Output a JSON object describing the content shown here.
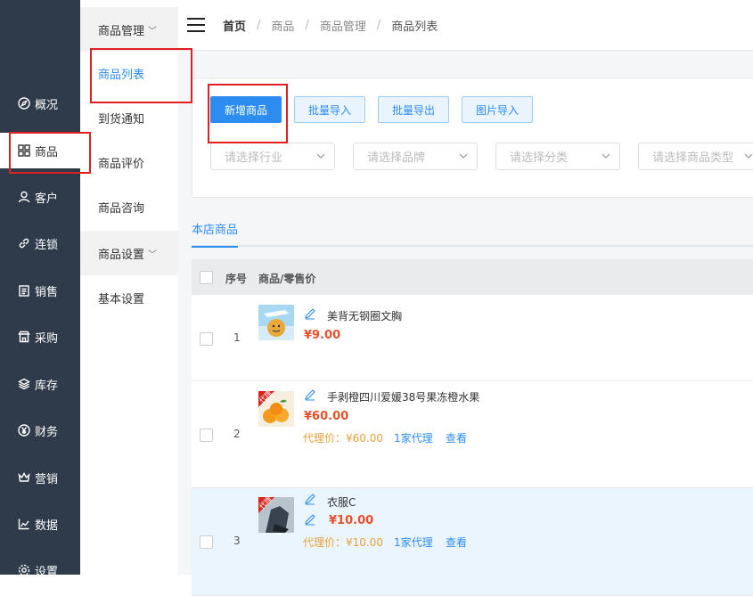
{
  "nav": {
    "items": [
      {
        "label": "概况",
        "icon": "compass-icon"
      },
      {
        "label": "商品",
        "icon": "grid-icon"
      },
      {
        "label": "客户",
        "icon": "user-icon"
      },
      {
        "label": "连锁",
        "icon": "link-icon"
      },
      {
        "label": "销售",
        "icon": "clipboard-icon"
      },
      {
        "label": "采购",
        "icon": "store-icon"
      },
      {
        "label": "库存",
        "icon": "layers-icon"
      },
      {
        "label": "财务",
        "icon": "yen-icon"
      },
      {
        "label": "营销",
        "icon": "crown-icon"
      },
      {
        "label": "数据",
        "icon": "line-chart-icon"
      },
      {
        "label": "设置",
        "icon": "gear-icon"
      }
    ]
  },
  "subnav": {
    "group1": "商品管理",
    "items1": [
      "商品列表",
      "到货通知",
      "商品评价",
      "商品咨询"
    ],
    "group2": "商品设置",
    "items2": [
      "基本设置"
    ]
  },
  "header": {
    "home": "首页",
    "crumb1": "商品",
    "crumb2": "商品管理",
    "crumb3": "商品列表"
  },
  "toolbar": {
    "add": "新增商品",
    "import": "批量导入",
    "export": "批量导出",
    "image_import": "图片导入"
  },
  "filters": {
    "industry": "请选择行业",
    "brand": "请选择品牌",
    "category": "请选择分类",
    "type": "请选择商品类型"
  },
  "tabs": {
    "store": "本店商品"
  },
  "table": {
    "col_index": "序号",
    "col_product": "商品/零售价",
    "rows": [
      {
        "index": "1",
        "name": "美背无钢圈文胸",
        "price": "¥9.00"
      },
      {
        "index": "2",
        "name": "手剥橙四川爱媛38号果冻橙水果",
        "price": "¥60.00",
        "agent_price": "代理价：¥60.00",
        "agent_count": "1家代理",
        "view": "查看",
        "badge": "代理"
      },
      {
        "index": "3",
        "name": "衣服C",
        "price": "¥10.00",
        "agent_price": "代理价：¥10.00",
        "agent_count": "1家代理",
        "view": "查看",
        "badge": "代理"
      }
    ]
  },
  "colors": {
    "accent": "#2d8cf0",
    "price": "#e6502b",
    "agent": "#e6a23c",
    "nav_bg": "#2f3a4b",
    "highlight": "#e02020"
  }
}
